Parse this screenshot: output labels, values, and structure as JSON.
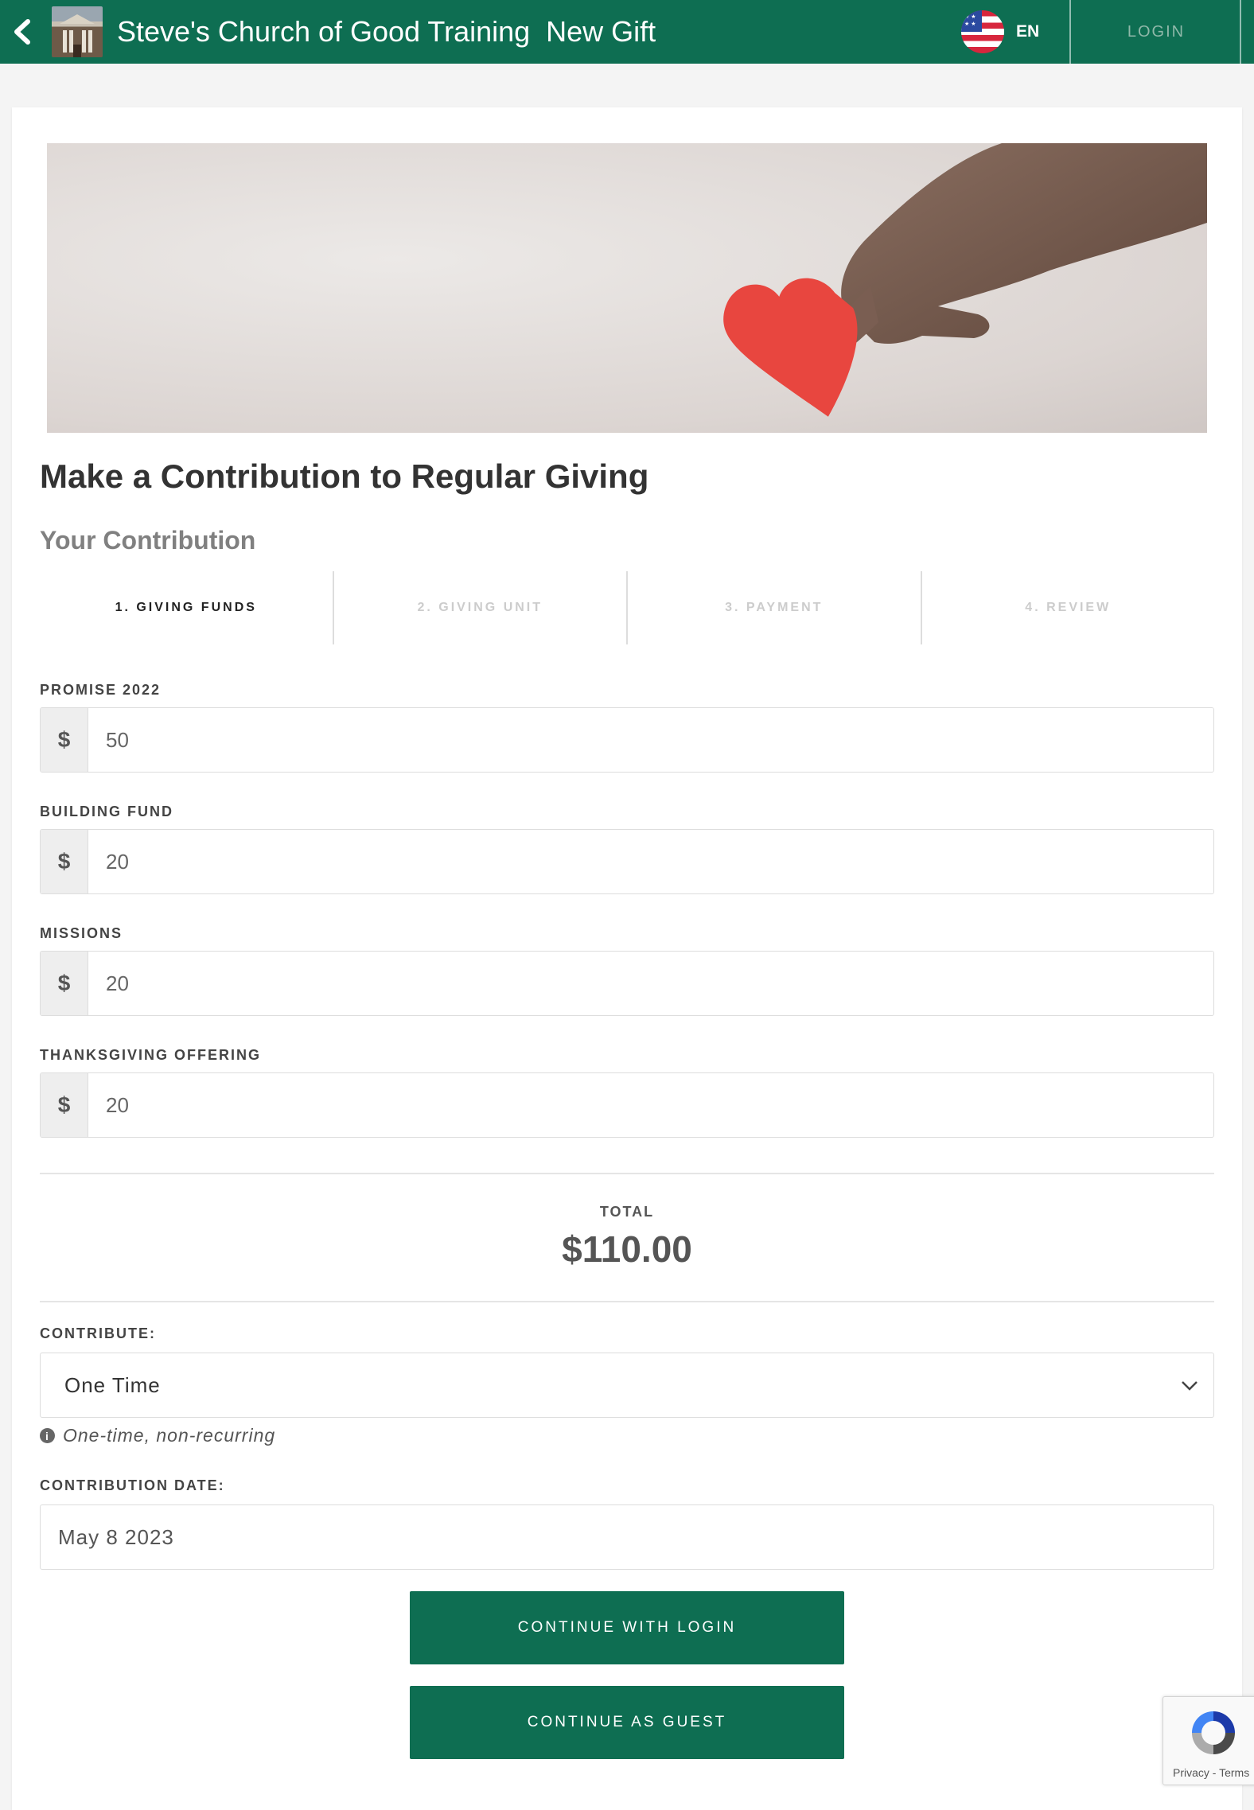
{
  "header": {
    "org_name": "Steve's Church of Good Training",
    "page_subtitle": "New Gift",
    "language_code": "EN",
    "login_label": "LOGIN"
  },
  "form": {
    "title": "Make a Contribution to Regular Giving",
    "subtitle": "Your Contribution",
    "steps": [
      {
        "label": "1. GIVING FUNDS",
        "active": true
      },
      {
        "label": "2. GIVING UNIT",
        "active": false
      },
      {
        "label": "3. PAYMENT",
        "active": false
      },
      {
        "label": "4. REVIEW",
        "active": false
      }
    ],
    "currency_symbol": "$",
    "funds": [
      {
        "label": "PROMISE 2022",
        "value": "50"
      },
      {
        "label": "BUILDING FUND",
        "value": "20"
      },
      {
        "label": "MISSIONS",
        "value": "20"
      },
      {
        "label": "THANKSGIVING OFFERING",
        "value": "20"
      }
    ],
    "total_label": "TOTAL",
    "total_value": "$110.00",
    "contribute_label": "CONTRIBUTE:",
    "contribute_value": "One Time",
    "contribute_help": "One-time, non-recurring",
    "date_label": "CONTRIBUTION DATE:",
    "date_value": "May 8 2023",
    "continue_login_label": "CONTINUE WITH LOGIN",
    "continue_guest_label": "CONTINUE AS GUEST"
  },
  "recaptcha": {
    "text": "Privacy - Terms"
  },
  "colors": {
    "brand": "#0e6e52",
    "heart": "#e8463f"
  }
}
